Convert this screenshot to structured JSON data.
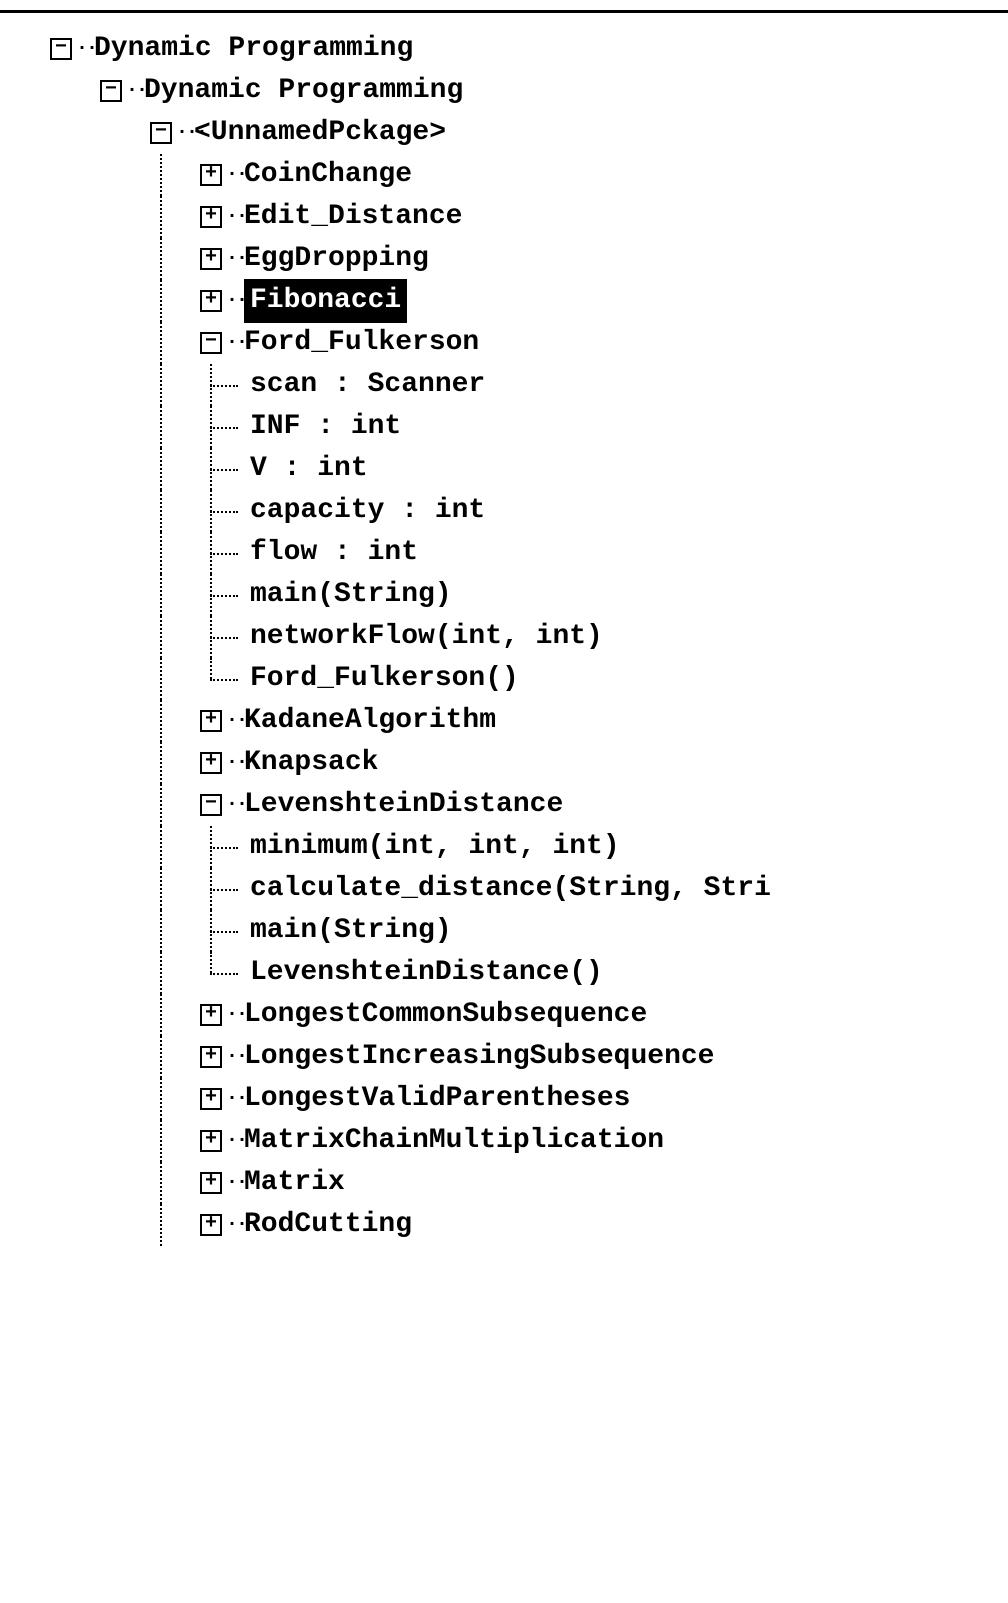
{
  "tree": {
    "root": "Dynamic Programming",
    "level1": "Dynamic Programming",
    "level2": "<UnnamedPckage>",
    "items": {
      "coinchange": "CoinChange",
      "edit_distance": "Edit_Distance",
      "eggdropping": "EggDropping",
      "fibonacci": "Fibonacci",
      "ford_fulkerson": "Ford_Fulkerson",
      "ford_children": {
        "scan": "scan : Scanner",
        "inf": "INF : int",
        "v": "V : int",
        "capacity": "capacity : int",
        "flow": "flow : int",
        "main": "main(String)",
        "networkflow": "networkFlow(int, int)",
        "constructor": "Ford_Fulkerson()"
      },
      "kadane": "KadaneAlgorithm",
      "knapsack": "Knapsack",
      "levenshtein": "LevenshteinDistance",
      "lev_children": {
        "minimum": "minimum(int, int, int)",
        "calculate": "calculate_distance(String, Stri",
        "main": "main(String)",
        "constructor": "LevenshteinDistance()"
      },
      "lcs": "LongestCommonSubsequence",
      "lis": "LongestIncreasingSubsequence",
      "lvp": "LongestValidParentheses",
      "mcm": "MatrixChainMultiplication",
      "matrix": "Matrix",
      "rodcutting": "RodCutting"
    }
  },
  "symbols": {
    "minus": "−",
    "plus": "+"
  }
}
